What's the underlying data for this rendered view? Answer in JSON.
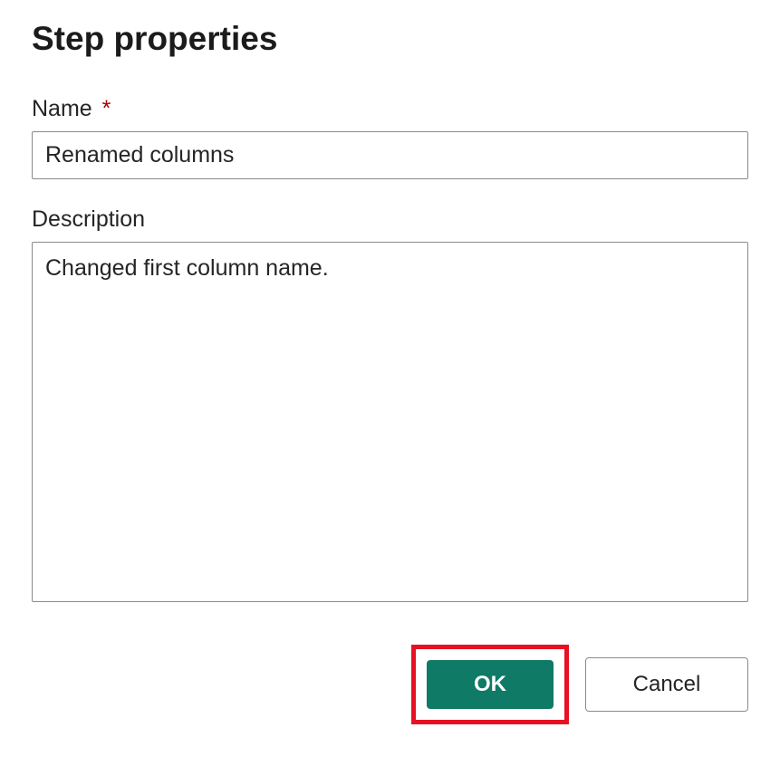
{
  "dialog": {
    "title": "Step properties",
    "fields": {
      "name": {
        "label": "Name",
        "required_mark": "*",
        "value": "Renamed columns"
      },
      "description": {
        "label": "Description",
        "value": "Changed first column name."
      }
    },
    "buttons": {
      "ok": "OK",
      "cancel": "Cancel"
    },
    "colors": {
      "primary_button_bg": "#0f7a66",
      "highlight_border": "#e81123",
      "required_asterisk": "#a80000"
    }
  }
}
